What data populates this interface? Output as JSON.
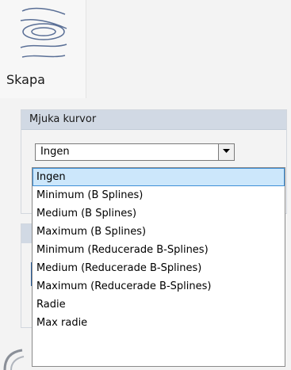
{
  "ribbon": {
    "create_label": "Skapa",
    "create_icon": "contour-lines-icon"
  },
  "panel": {
    "title": "Mjuka kurvor",
    "combo_value": "Ingen"
  },
  "dropdown": {
    "options": [
      "Ingen",
      "Minimum (B Splines)",
      "Medium (B Splines)",
      "Maximum (B Splines)",
      "Minimum (Reducerade B-Splines)",
      "Medium (Reducerade B-Splines)",
      "Maximum (Reducerade B-Splines)",
      "Radie",
      "Max radie"
    ],
    "selected_index": 0
  },
  "colors": {
    "header_bg": "#d1d9e4",
    "selection_bg": "#cce7fb",
    "selection_border": "#3d8fd6"
  }
}
